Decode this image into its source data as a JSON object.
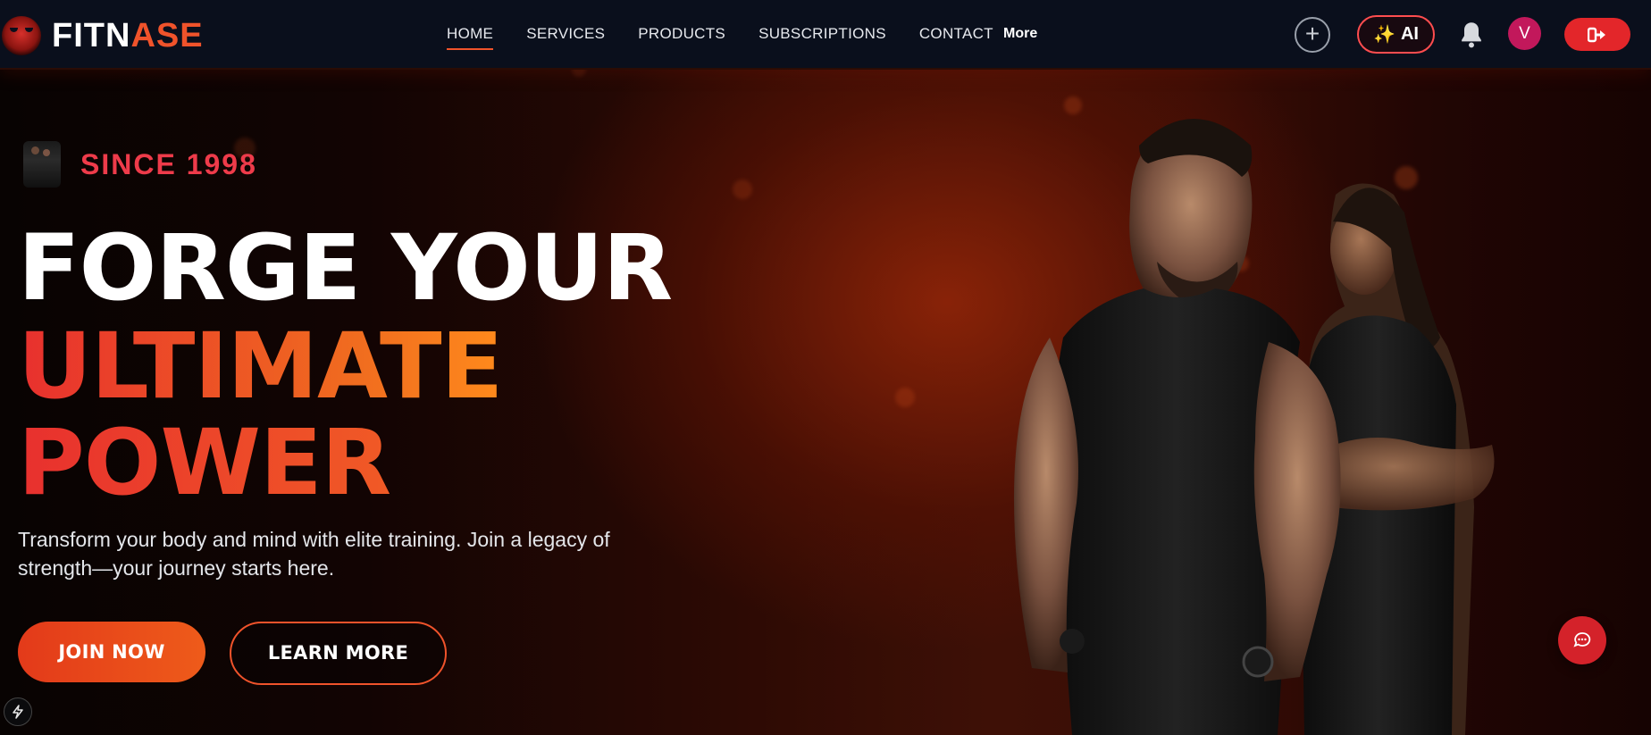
{
  "brand": {
    "part1": "FITN",
    "part2": "ASE"
  },
  "nav": {
    "items": [
      {
        "label": "HOME",
        "active": true
      },
      {
        "label": "SERVICES"
      },
      {
        "label": "PRODUCTS"
      },
      {
        "label": "SUBSCRIPTIONS"
      },
      {
        "label": "CONTACT"
      }
    ],
    "more_label": "More",
    "ai_label": "AI",
    "avatar_initial": "V",
    "icons": [
      "plus-icon",
      "sparkle-icon",
      "bell-icon",
      "logout-icon"
    ]
  },
  "hero": {
    "since": "SINCE 1998",
    "headline_1": "FORGE YOUR",
    "headline_2": "ULTIMATE",
    "headline_3": "POWER",
    "subtitle": "Transform your body and mind with elite training. Join a legacy of strength—your journey starts here.",
    "join_label": "JOIN NOW",
    "learn_label": "LEARN MORE"
  },
  "colors": {
    "accent": "#f0532b",
    "since": "#ee3b4a",
    "logout": "#e3262a",
    "avatar": "#c2185b",
    "chat": "#d4222a"
  }
}
